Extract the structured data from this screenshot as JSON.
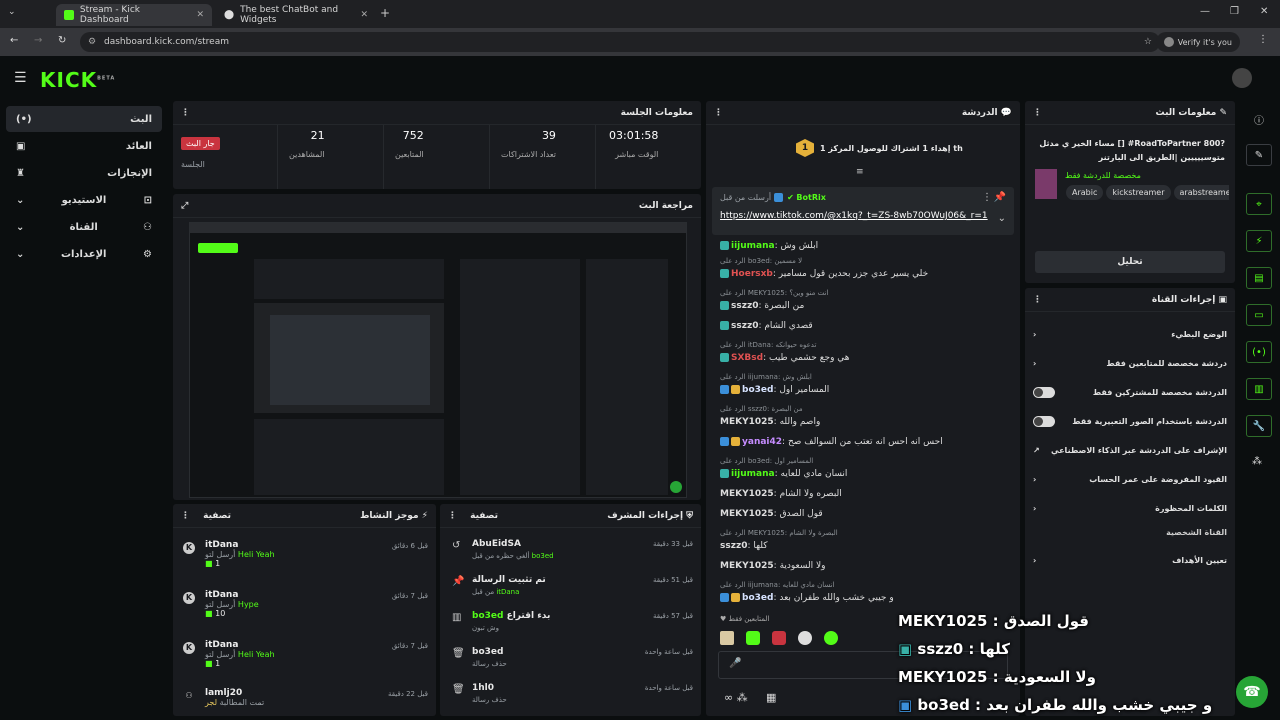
{
  "browser": {
    "tabs": [
      {
        "title": "Stream - Kick Dashboard",
        "active": true
      },
      {
        "title": "The best ChatBot and Widgets",
        "active": false
      }
    ],
    "url": "dashboard.kick.com/stream",
    "verify": "Verify it's you"
  },
  "brand": {
    "logo": "KICK",
    "beta": "BETA",
    "accent": "#53fc18"
  },
  "sidebar": {
    "items": [
      {
        "label": "البث",
        "icon": "broadcast-icon",
        "active": true
      },
      {
        "label": "العائد",
        "icon": "dollar-icon"
      },
      {
        "label": "الإنجازات",
        "icon": "trophy-icon"
      },
      {
        "label": "الاستيديو",
        "icon": "studio-icon",
        "expandable": true
      },
      {
        "label": "القناة",
        "icon": "channel-icon",
        "expandable": true
      },
      {
        "label": "الإعدادات",
        "icon": "gear-icon",
        "expandable": true
      }
    ]
  },
  "session": {
    "title": "معلومات الجلسة",
    "live_label": "جار البث",
    "session_label": "الجلسة",
    "stats": [
      {
        "value": "03:01:58",
        "label": "الوقت مباشر"
      },
      {
        "value": "39",
        "label": "تعداد الاشتراكات"
      },
      {
        "value": "752",
        "label": "المتابعين"
      },
      {
        "value": "21",
        "label": "المشاهدين"
      }
    ]
  },
  "preview": {
    "title": "مراجعة البث"
  },
  "activity": {
    "title": "موجز النشاط",
    "filter": "تصفية",
    "rows": [
      {
        "name": "itDana",
        "action": "أرسل لتو",
        "message": "Heli Yeah",
        "amount": "1",
        "time": "قبل 6 دقائق"
      },
      {
        "name": "itDana",
        "action": "أرسل لتو",
        "message": "Hype",
        "amount": "10",
        "time": "قبل 7 دقائق"
      },
      {
        "name": "itDana",
        "action": "أرسل لتو",
        "message": "Heli Yeah",
        "amount": "1",
        "time": "قبل 7 دقائق"
      },
      {
        "name": "lamlj20",
        "action": "تمت المطالبة",
        "message": "لجر",
        "amount": "",
        "time": "قبل 22 دقيقة"
      }
    ]
  },
  "moderator": {
    "title": "إجراءات المشرف",
    "filter": "تصفية",
    "rows": [
      {
        "title": "AbuEidSA",
        "sub_user": "bo3ed",
        "sub": "ألغي حظره من قبل",
        "time": "قبل 33 دقيقة",
        "icon": "undo-icon"
      },
      {
        "title": "تم تثبيت الرسالة",
        "sub_user": "itDana",
        "sub": "من قبل",
        "time": "قبل 51 دقيقة",
        "icon": "pin-icon"
      },
      {
        "title": "بدء اقتراع",
        "title_user": "bo3ed",
        "sub": "وش تبون",
        "time": "قبل 57 دقيقة",
        "icon": "poll-icon"
      },
      {
        "title": "bo3ed",
        "sub": "حذف رسالة",
        "time": "قبل ساعة واحدة",
        "icon": "trash-icon"
      },
      {
        "title": "1hl0",
        "sub": "حذف رسالة",
        "time": "قبل ساعة واحدة",
        "icon": "trash-icon"
      }
    ]
  },
  "chat": {
    "title": "الدردشة",
    "goal_text": "إهداء 1 اشتراك للوصول المركز 1 th",
    "goal_rank": "1",
    "pinned_by": "أرسلت من قبل",
    "pinned_user": "BotRix",
    "pinned_link": "https://www.tiktok.com/@x1kq?_t=ZS-8wb70OWuJ06&_r=1",
    "followers_only": "المتابعين فقط",
    "messages": [
      {
        "reply": "",
        "user": "iijumana",
        "color": "#53fc18",
        "text": "ابلش وش"
      },
      {
        "reply": "الرد على bo3ed: لا مسمين",
        "user": "Hoersxb",
        "color": "#e05252",
        "text": "خلي يسير عدي جزر بحدين قول مسامير"
      },
      {
        "reply": "الرد على MEKY1025: انت منو وين؟",
        "user": "sszz0",
        "color": "#ffffff",
        "text": "من البصرة"
      },
      {
        "reply": "",
        "user": "sszz0",
        "color": "#ffffff",
        "text": "قصدي الشام"
      },
      {
        "reply": "الرد على itDana: تدعوه حيوانكه",
        "user": "SXBsd",
        "color": "#e05252",
        "text": "هي وجع حشمي طيب"
      },
      {
        "reply": "الرد على iijumana: ابلش وش",
        "user": "bo3ed",
        "color": "#d7e3ff",
        "text": "المسامير اول"
      },
      {
        "reply": "الرد على sszz0: من البصرة",
        "user": "MEKY1025",
        "color": "#ffffff",
        "text": "واصم والله"
      },
      {
        "reply": "",
        "user": "yanai42",
        "color": "#c58cff",
        "text": "احس انه احس انه تعتب من السوالف صح"
      },
      {
        "reply": "الرد على bo3ed: المسامير اول",
        "user": "iijumana",
        "color": "#53fc18",
        "text": "انسان مادي للعايه"
      },
      {
        "reply": "",
        "user": "MEKY1025",
        "color": "#ffffff",
        "text": "البصره ولا الشام"
      },
      {
        "reply": "",
        "user": "MEKY1025",
        "color": "#ffffff",
        "text": "قول الصدق"
      },
      {
        "reply": "الرد على MEKY1025: البصرة ولا الشام",
        "user": "sszz0",
        "color": "#ffffff",
        "text": "كلها"
      },
      {
        "reply": "",
        "user": "MEKY1025",
        "color": "#ffffff",
        "text": "ولا السعودية"
      },
      {
        "reply": "الرد على iijumana: انسان مادي للعايه",
        "user": "bo3ed",
        "color": "#d7e3ff",
        "text": "و جيبي خشب والله طفران بعد"
      }
    ]
  },
  "stream_info": {
    "title": "معلومات البث",
    "stream_title": "مساء الخير ي مدثل [] #RoadToPartner 800? متوسييييين |الطريق الى البارتنر",
    "category": "مخصصة للدردشة فقط",
    "tags": [
      "arabstreame",
      "kickstreamer",
      "Arabic"
    ],
    "edit_button": "تحليل"
  },
  "channel_actions": {
    "title": "إجراءات القناة",
    "items": [
      {
        "label": "الوضع البطيء",
        "control": "chevron"
      },
      {
        "label": "دردشة مخصصة للمتابعين فقط",
        "control": "chevron"
      },
      {
        "label": "الدردشة مخصصة للمشتركين فقط",
        "control": "toggle"
      },
      {
        "label": "الدردشة باستخدام الصور التعبيرية فقط",
        "control": "toggle"
      },
      {
        "label": "الإشراف على الدردشة عبر الذكاء الاصطناعي",
        "control": "external"
      },
      {
        "label": "القيود المفروضة على عمر الحساب",
        "control": "chevron"
      },
      {
        "label": "الكلمات المحظورة",
        "control": "chevron"
      }
    ],
    "section_label": "القناة الشخصية",
    "goals_label": "تعيين الأهداف"
  },
  "overlay": {
    "lines": [
      {
        "user": "MEKY1025",
        "text": "قول الصدق"
      },
      {
        "user": "sszz0",
        "text": "كلها"
      },
      {
        "user": "MEKY1025",
        "text": "ولا السعودية"
      },
      {
        "user": "bo3ed",
        "text": "و جيبي خشب والله طفران بعد"
      }
    ]
  }
}
